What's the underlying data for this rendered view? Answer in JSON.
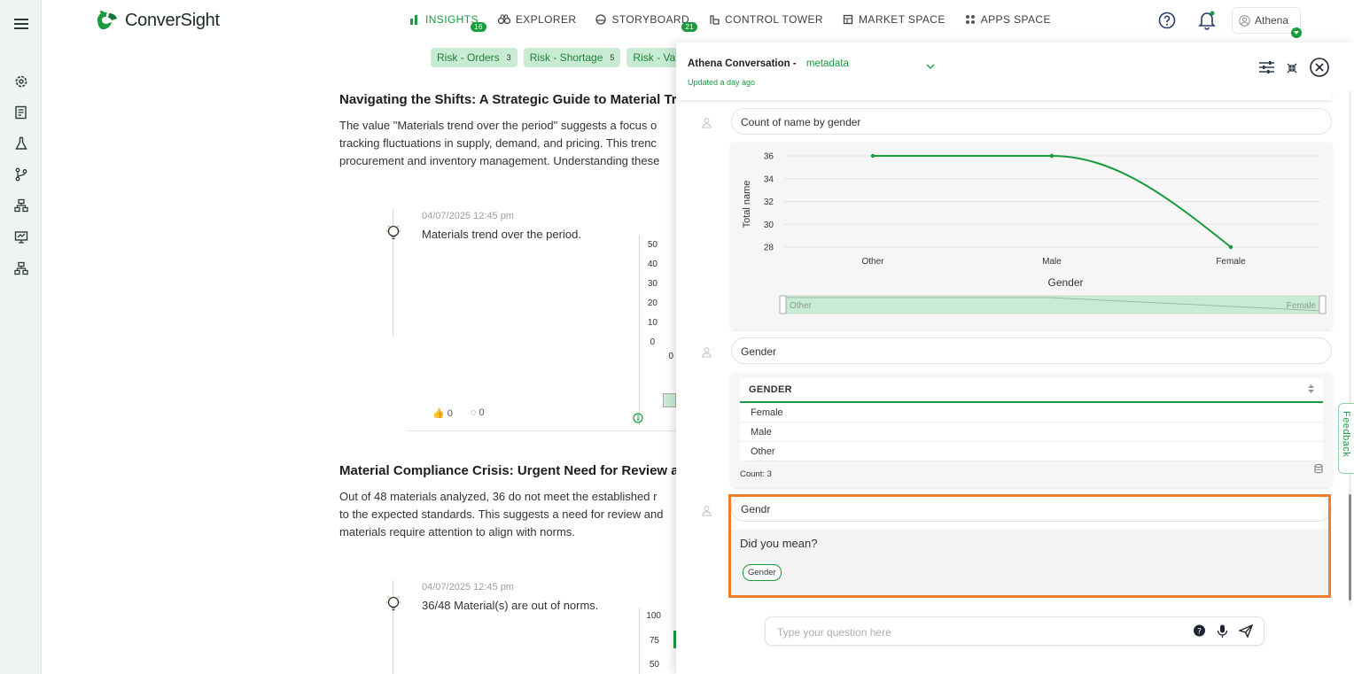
{
  "brand": {
    "name": "ConverSight",
    "accent": "#1a9b3e",
    "highlight": "#f07d2a"
  },
  "nav": [
    {
      "label": "INSIGHTS",
      "badge": "16",
      "icon": "bar-chart-icon",
      "active": true
    },
    {
      "label": "EXPLORER",
      "icon": "binoculars-icon"
    },
    {
      "label": "STORYBOARD",
      "badge": "21",
      "icon": "storyboard-icon"
    },
    {
      "label": "CONTROL TOWER",
      "icon": "tower-icon"
    },
    {
      "label": "MARKET SPACE",
      "icon": "market-icon"
    },
    {
      "label": "APPS SPACE",
      "icon": "apps-grid-icon"
    }
  ],
  "user": {
    "name": "Athena"
  },
  "sidebar": [
    "menu-icon",
    "settings-icon",
    "report-icon",
    "flask-icon",
    "branch-icon",
    "hierarchy-icon",
    "presentation-icon",
    "org-chart-icon"
  ],
  "chips": [
    {
      "label": "Risk - Orders",
      "count": "3"
    },
    {
      "label": "Risk - Shortage",
      "count": "5"
    },
    {
      "label": "Risk - Va",
      "count": ""
    }
  ],
  "insight1": {
    "title": "Navigating the Shifts: A Strategic Guide to Material Trenc",
    "lines": [
      "The value \"Materials trend over the period\" suggests a focus o",
      "tracking fluctuations in supply, demand, and pricing. This trenc",
      "procurement and inventory management. Understanding these"
    ],
    "timestamp": "04/07/2025 12:45 pm",
    "text": "Materials trend over the period.",
    "ticks": [
      "50",
      "40",
      "30",
      "20",
      "10",
      "0"
    ],
    "likes": "0",
    "comments": "0",
    "stub_label": "0"
  },
  "insight2": {
    "title": "Material Compliance Crisis: Urgent Need for Review and",
    "lines": [
      "Out of 48 materials analyzed, 36 do not meet the established r",
      "to the expected standards. This suggests a need for review and",
      "materials require attention to align with norms."
    ],
    "timestamp": "04/07/2025 12:45 pm",
    "text": "36/48 Material(s) are out of norms.",
    "ticks": [
      "100",
      "75",
      "50"
    ]
  },
  "panel": {
    "title": "Athena Conversation -",
    "dataset": "metadata",
    "updated": "Updated a day ago",
    "question1": "Count of name by gender",
    "question2": "Gender",
    "question3": "Gendr",
    "did_you_mean": "Did you mean?",
    "suggestion": "Gender",
    "input_placeholder": "Type your question here",
    "feedback": "Feedback"
  },
  "chart_data": {
    "type": "line",
    "categories": [
      "Other",
      "Male",
      "Female"
    ],
    "series": [
      {
        "values": [
          36,
          36,
          28
        ]
      }
    ],
    "xlabel": "Gender",
    "ylabel": "Total name",
    "ylim": [
      28,
      36
    ],
    "yticks": [
      28,
      30,
      32,
      34,
      36
    ],
    "grid": true,
    "slider": {
      "start": "Other",
      "end": "Female"
    }
  },
  "table": {
    "header": "GENDER",
    "rows": [
      "Female",
      "Male",
      "Other"
    ],
    "count": "Count: 3"
  }
}
